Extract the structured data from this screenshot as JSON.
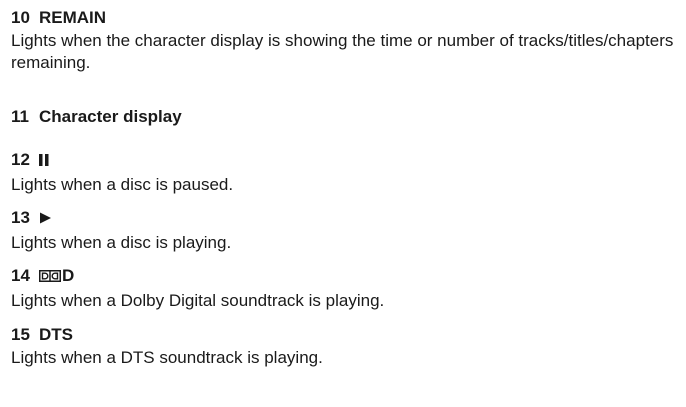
{
  "items": [
    {
      "number": "10",
      "title": "REMAIN",
      "description": "Lights when the character display is showing the time or number of tracks/titles/chapters remaining."
    },
    {
      "number": "11",
      "title": "Character display",
      "description": ""
    },
    {
      "number": "12",
      "title": "",
      "icon": "pause-icon",
      "description": "Lights when a disc is paused."
    },
    {
      "number": "13",
      "title": "",
      "icon": "play-icon",
      "description": "Lights when a disc is playing."
    },
    {
      "number": "14",
      "title": "D",
      "icon": "double-d-logo-icon",
      "description": "Lights when a Dolby Digital soundtrack is playing."
    },
    {
      "number": "15",
      "title": "DTS",
      "description": "Lights when a DTS soundtrack is playing."
    }
  ]
}
